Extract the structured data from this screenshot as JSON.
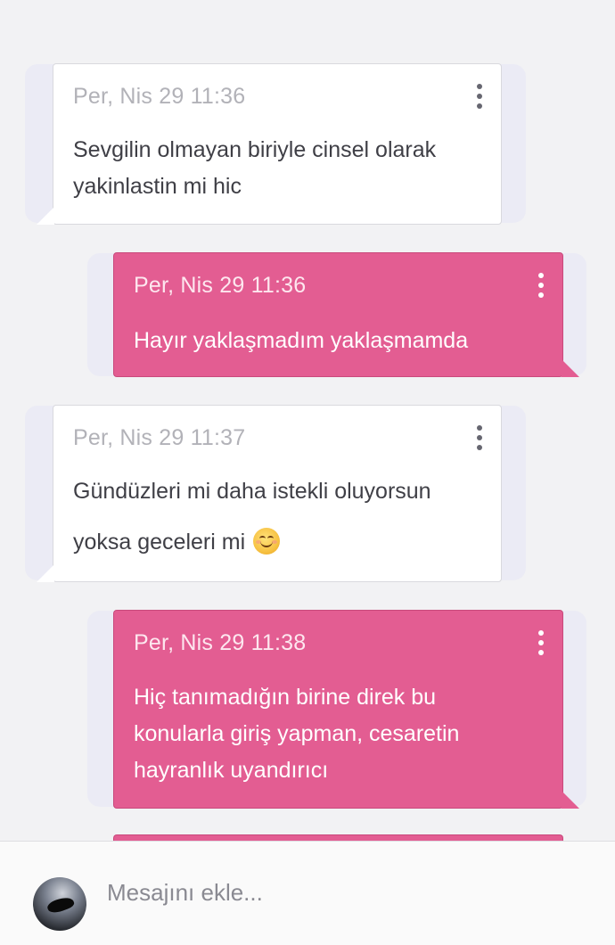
{
  "messages": [
    {
      "direction": "incoming",
      "timestamp": "Per, Nis 29 11:36",
      "lines": [
        "Sevgilin olmayan biriyle cinsel olarak",
        "yakinlastin mi hic"
      ]
    },
    {
      "direction": "outgoing",
      "timestamp": "Per, Nis 29 11:36",
      "lines": [
        "Hayır yaklaşmadım yaklaşmamda"
      ]
    },
    {
      "direction": "incoming",
      "timestamp": "Per, Nis 29 11:37",
      "lines": [
        "Gündüzleri mi daha istekli oluyorsun",
        "yoksa geceleri mi"
      ],
      "emoji": "smiling-face-icon"
    },
    {
      "direction": "outgoing",
      "timestamp": "Per, Nis 29 11:38",
      "lines": [
        "Hiç tanımadığın birine direk bu",
        "konularla giriş yapman, cesaretin",
        "hayranlık uyandırıcı"
      ]
    }
  ],
  "composer": {
    "placeholder": "Mesajını ekle...",
    "avatar_icon": "user-avatar"
  },
  "colors": {
    "background": "#f2f2f4",
    "incoming_bubble": "#ffffff",
    "outgoing_bubble": "#e35d92"
  }
}
